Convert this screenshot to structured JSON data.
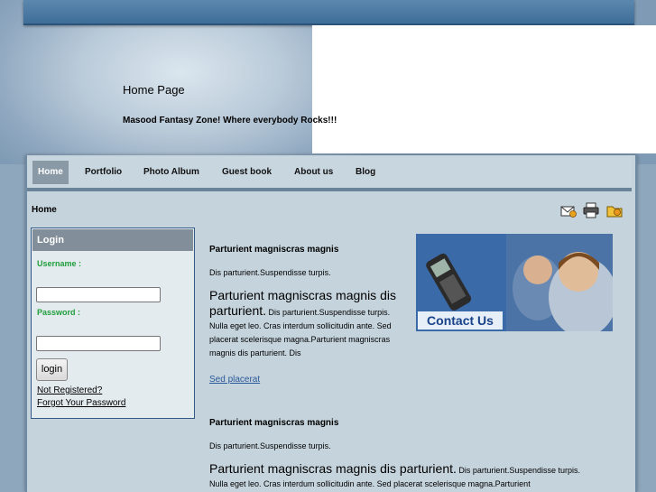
{
  "site": {
    "title": "Home Page",
    "slogan": "Masood Fantasy Zone! Where everybody Rocks!!!"
  },
  "nav": {
    "items": [
      {
        "label": "Home",
        "active": true
      },
      {
        "label": "Portfolio"
      },
      {
        "label": "Photo Album"
      },
      {
        "label": "Guest book"
      },
      {
        "label": "About us"
      },
      {
        "label": "Blog"
      }
    ]
  },
  "breadcrumb": "Home",
  "tools": {
    "icons": [
      "email-icon",
      "print-icon",
      "bookmark-folder-icon"
    ]
  },
  "login": {
    "heading": "Login",
    "username_label": "Username :",
    "password_label": "Password :",
    "button": "login",
    "not_registered": "Not Registered?",
    "forgot_password": "Forgot Your Password"
  },
  "articles": [
    {
      "title": "Parturient magniscras magnis",
      "intro": "Dis parturient.Suspendisse turpis.",
      "lead": "Parturient magniscras magnis dis parturient.",
      "body": " Dis parturient.Suspendisse turpis. Nulla eget leo. Cras interdum sollicitudin ante. Sed placerat scelerisque magna.Parturient magniscras magnis dis parturient. Dis",
      "link": "Sed placerat"
    },
    {
      "title": "Parturient magniscras magnis",
      "intro": "Dis parturient.Suspendisse turpis.",
      "lead": "Parturient magniscras magnis dis parturient.",
      "body": " Dis parturient.Suspendisse turpis. Nulla eget leo. Cras interdum sollicitudin ante. Sed placerat scelerisque magna.Parturient"
    }
  ],
  "contact_banner": {
    "label": "Contact Us",
    "colors": {
      "text": "#17418a",
      "background": "#2a548f"
    }
  },
  "colors": {
    "accent": "#3e6e99",
    "nav_active": "#8a99a6",
    "label_green": "#1f9e3a",
    "content_bg": "#c5d3dc"
  }
}
